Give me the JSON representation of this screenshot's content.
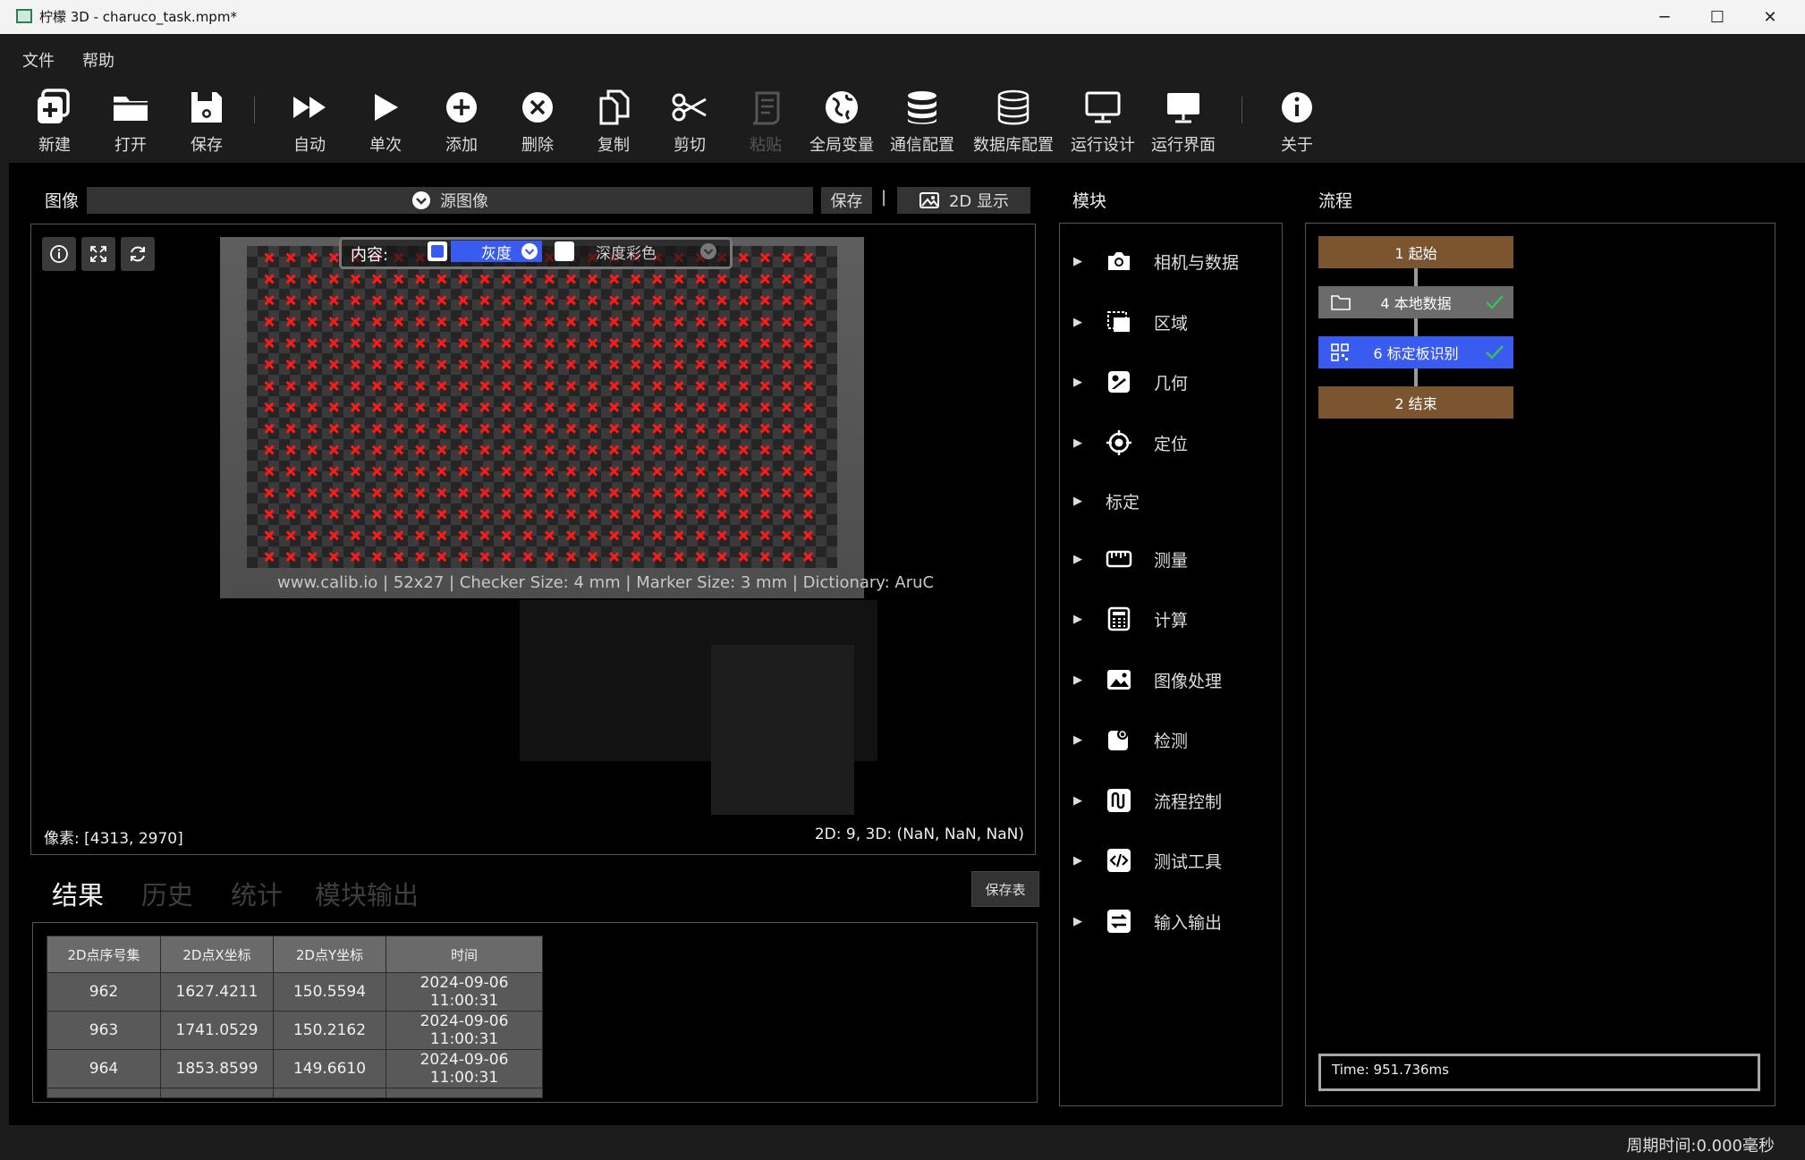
{
  "window": {
    "title": "柠檬 3D  - charuco_task.mpm*",
    "minimize": "─",
    "maximize": "☐",
    "close": "✕"
  },
  "menu": {
    "items": [
      "文件",
      "帮助"
    ]
  },
  "toolbar": {
    "items": [
      {
        "icon": "new-icon",
        "label": "新建"
      },
      {
        "icon": "open-folder-icon",
        "label": "打开"
      },
      {
        "icon": "save-icon",
        "label": "保存"
      },
      {
        "icon": "fast-forward-icon",
        "label": "自动"
      },
      {
        "icon": "play-icon",
        "label": "单次"
      },
      {
        "icon": "plus-circle-icon",
        "label": "添加"
      },
      {
        "icon": "x-circle-icon",
        "label": "删除"
      },
      {
        "icon": "copy-icon",
        "label": "复制"
      },
      {
        "icon": "scissors-icon",
        "label": "剪切"
      },
      {
        "icon": "paste-icon",
        "label": "粘贴",
        "disabled": true
      },
      {
        "icon": "globe-icon",
        "label": "全局变量"
      },
      {
        "icon": "database-icon",
        "label": "通信配置"
      },
      {
        "icon": "database-icon",
        "label": "数据库配置"
      },
      {
        "icon": "monitor-icon",
        "label": "运行设计"
      },
      {
        "icon": "monitor-icon",
        "label": "运行界面"
      },
      {
        "icon": "info-icon",
        "label": "关于"
      }
    ]
  },
  "image_panel": {
    "header": "图像",
    "source_select": "源图像",
    "save_label": "保存",
    "divider": "|",
    "display_mode": "2D 显示",
    "overlay": {
      "content_label": "内容:",
      "gray_option": "灰度",
      "depth_option": "深度彩色"
    },
    "board_caption": "www.calib.io | 52x27 | Checker Size: 4 mm | Marker Size: 3 mm | Dictionary: AruC",
    "pixel_readout": "像素: [4313, 2970]",
    "coord_readout": "2D: 9, 3D: (NaN, NaN, NaN)"
  },
  "results": {
    "tabs": [
      "结果",
      "历史",
      "统计",
      "模块输出"
    ],
    "active_tab": 0,
    "save_table_label": "保存表",
    "columns": [
      "2D点序号集",
      "2D点X坐标",
      "2D点Y坐标",
      "时间"
    ],
    "rows": [
      [
        "962",
        "1627.4211",
        "150.5594",
        "2024-09-06 11:00:31"
      ],
      [
        "963",
        "1741.0529",
        "150.2162",
        "2024-09-06 11:00:31"
      ],
      [
        "964",
        "1853.8599",
        "149.6610",
        "2024-09-06 11:00:31"
      ]
    ]
  },
  "modules": {
    "header": "模块",
    "items": [
      {
        "icon": "camera-icon",
        "label": "相机与数据"
      },
      {
        "icon": "region-icon",
        "label": "区域"
      },
      {
        "icon": "geometry-icon",
        "label": "几何"
      },
      {
        "icon": "target-icon",
        "label": "定位"
      },
      {
        "icon": "",
        "label": "标定"
      },
      {
        "icon": "ruler-icon",
        "label": "测量"
      },
      {
        "icon": "calculator-icon",
        "label": "计算"
      },
      {
        "icon": "image-icon",
        "label": "图像处理"
      },
      {
        "icon": "detect-icon",
        "label": "检测"
      },
      {
        "icon": "flow-control-icon",
        "label": "流程控制"
      },
      {
        "icon": "code-icon",
        "label": "测试工具"
      },
      {
        "icon": "io-icon",
        "label": "输入输出"
      }
    ]
  },
  "flow": {
    "header": "流程",
    "nodes": [
      {
        "label": "1 起始",
        "color": "#7a5530",
        "icon": "",
        "check": false
      },
      {
        "label": "4 本地数据",
        "color": "#6b6b6b",
        "icon": "folder-icon",
        "check": true
      },
      {
        "label": "6 标定板识别",
        "color": "#3a5bf0",
        "icon": "qr-icon",
        "check": true
      },
      {
        "label": "2 结束",
        "color": "#7a5530",
        "icon": "",
        "check": false
      }
    ],
    "check_color": "#35c25a",
    "time": "Time: 951.736ms"
  },
  "status": {
    "cycle_time": "周期时间:0.000毫秒"
  },
  "colors": {
    "accent_blue": "#3a5bf0",
    "corner_marker": "#ff1a1a",
    "panel_border": "#555555"
  }
}
